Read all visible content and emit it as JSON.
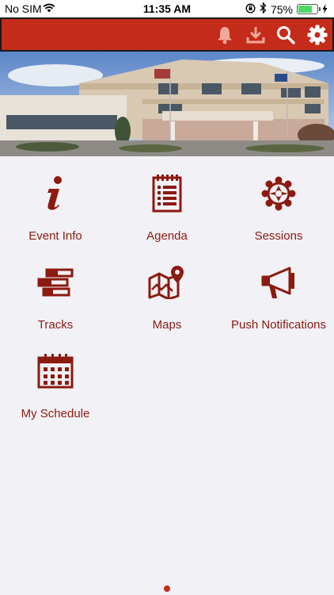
{
  "status_bar": {
    "carrier": "No SIM",
    "time": "11:35 AM",
    "battery": "75%"
  },
  "toolbar": {
    "icons": [
      "bell-icon",
      "download-icon",
      "search-icon",
      "gear-icon"
    ]
  },
  "tiles": [
    {
      "label": "Event Info",
      "icon": "info-icon"
    },
    {
      "label": "Agenda",
      "icon": "notepad-icon"
    },
    {
      "label": "Sessions",
      "icon": "network-icon"
    },
    {
      "label": "Tracks",
      "icon": "tracks-icon"
    },
    {
      "label": "Maps",
      "icon": "map-icon"
    },
    {
      "label": "Push Notifications",
      "icon": "megaphone-icon"
    },
    {
      "label": "My Schedule",
      "icon": "calendar-icon"
    }
  ],
  "colors": {
    "accent": "#c42b1b",
    "tile_text": "#8b1a10",
    "background": "#f2f1f5"
  }
}
